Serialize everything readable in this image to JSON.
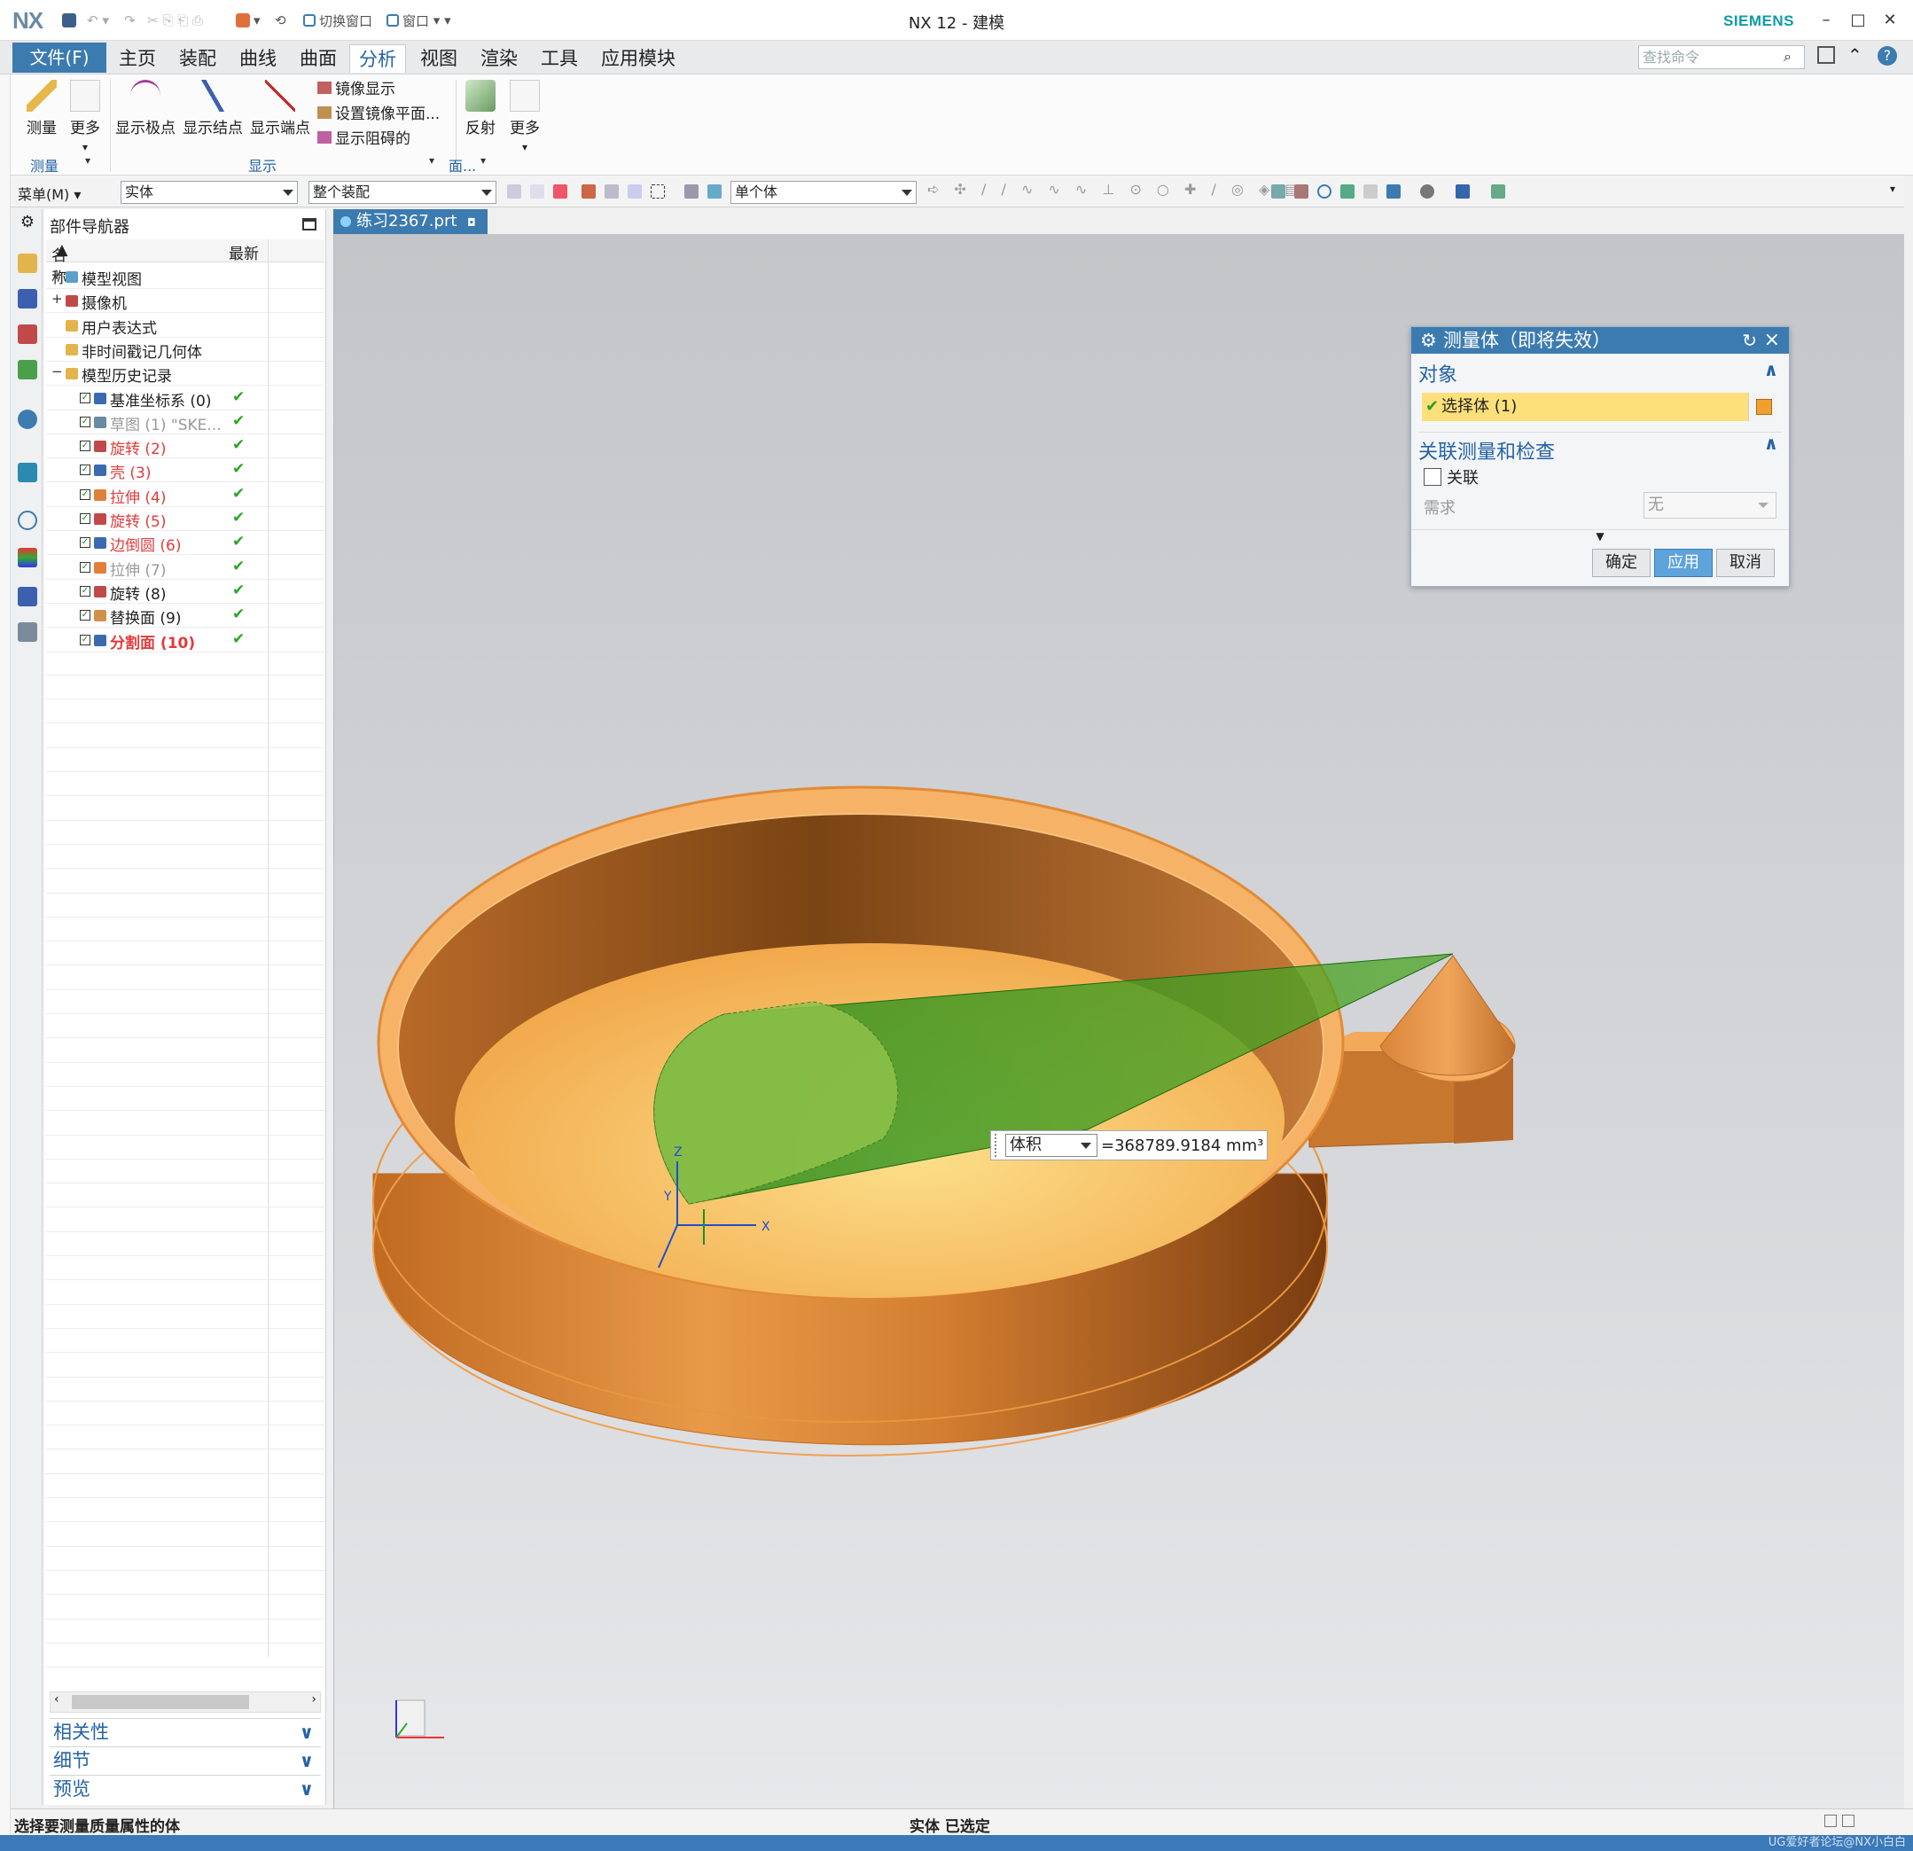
{
  "titlebar": {
    "logo": "NX",
    "window_title": "NX 12 - 建模",
    "brand": "SIEMENS",
    "switch_window": "切换窗口",
    "window_menu": "窗口",
    "minimize": "–",
    "maximize": "□",
    "close": "✕"
  },
  "menubar": {
    "file": "文件(F)",
    "tabs": [
      "主页",
      "装配",
      "曲线",
      "曲面",
      "分析",
      "视图",
      "渲染",
      "工具",
      "应用模块"
    ],
    "active_tab": "分析",
    "search_placeholder": "查找命令"
  },
  "ribbon": {
    "measure": "测量",
    "more": "更多",
    "show_poles": "显示极点",
    "show_knots": "显示结点",
    "show_endpoints": "显示端点",
    "mirror_display": "镜像显示",
    "set_mirror_plane": "设置镜像平面...",
    "show_obstruction": "显示阻碍的",
    "reflect": "反射",
    "more2": "更多",
    "group_measure": "测量",
    "group_display": "显示",
    "group_face": "面..."
  },
  "selbar": {
    "menu": "菜单(M)",
    "filter_type": "实体",
    "scope": "整个装配",
    "body_filter": "单个体"
  },
  "navigator": {
    "title": "部件导航器",
    "col_name": "名称",
    "col_latest": "最新",
    "rows": [
      {
        "label": "模型视图",
        "style": "normal",
        "check": ""
      },
      {
        "label": "摄像机",
        "style": "normal",
        "check": ""
      },
      {
        "label": "用户表达式",
        "style": "normal",
        "check": ""
      },
      {
        "label": "非时间戳记几何体",
        "style": "normal",
        "check": ""
      },
      {
        "label": "模型历史记录",
        "style": "normal",
        "check": ""
      },
      {
        "label": "基准坐标系 (0)",
        "style": "normal",
        "check": "✔"
      },
      {
        "label": "草图 (1) \"SKE...",
        "style": "grey",
        "check": "✔"
      },
      {
        "label": "旋转 (2)",
        "style": "red",
        "check": "✔"
      },
      {
        "label": "壳 (3)",
        "style": "red",
        "check": "✔"
      },
      {
        "label": "拉伸 (4)",
        "style": "red",
        "check": "✔"
      },
      {
        "label": "旋转 (5)",
        "style": "red",
        "check": "✔"
      },
      {
        "label": "边倒圆 (6)",
        "style": "red",
        "check": "✔"
      },
      {
        "label": "拉伸 (7)",
        "style": "grey",
        "check": "✔"
      },
      {
        "label": "旋转 (8)",
        "style": "normal",
        "check": "✔"
      },
      {
        "label": "替换面 (9)",
        "style": "normal",
        "check": "✔"
      },
      {
        "label": "分割面 (10)",
        "style": "bold-red",
        "check": "✔"
      }
    ],
    "panels": [
      "相关性",
      "细节",
      "预览"
    ]
  },
  "document": {
    "tab": "练习2367.prt"
  },
  "viewport": {
    "measure_type": "体积",
    "measure_value": "=368789.9184 mm³",
    "axis_x": "X",
    "axis_y": "Y",
    "axis_z": "Z",
    "model_color": "#e8963c",
    "cone_color": "#1f8f1f"
  },
  "dialog": {
    "title": "测量体（即将失效）",
    "section_object": "对象",
    "select_body": "选择体 (1)",
    "section_assoc": "关联测量和检查",
    "assoc_label": "关联",
    "requirement_label": "需求",
    "requirement_value": "无",
    "ok": "确定",
    "apply": "应用",
    "cancel": "取消"
  },
  "status": {
    "prompt": "选择要测量质量属性的体",
    "selection": "实体 已选定",
    "watermark": "UG爱好者论坛@NX小白白"
  }
}
